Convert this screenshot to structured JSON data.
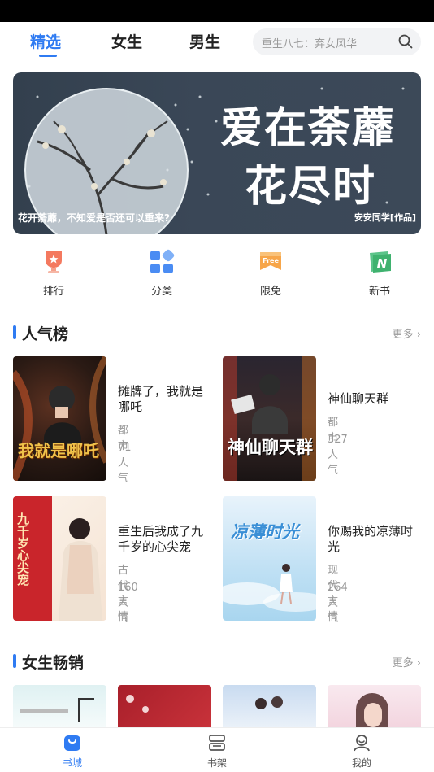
{
  "top_tabs": [
    {
      "label": "精选",
      "active": true
    },
    {
      "label": "女生",
      "active": false
    },
    {
      "label": "男生",
      "active": false
    }
  ],
  "search": {
    "placeholder": "重生八七：弃女风华",
    "icon": "search-icon"
  },
  "banner": {
    "title_line1": "爱在荼蘼",
    "title_line2": "花尽时",
    "caption": "花开荼蘼，不知爱是否还可以重来?",
    "author": "安安同学[作品]"
  },
  "quick_entries": [
    {
      "label": "排行",
      "icon": "trophy-icon"
    },
    {
      "label": "分类",
      "icon": "category-grid-icon"
    },
    {
      "label": "限免",
      "icon": "free-tag-icon"
    },
    {
      "label": "新书",
      "icon": "new-book-icon"
    }
  ],
  "sections": {
    "popular": {
      "title": "人气榜",
      "more": "更多",
      "books": [
        {
          "title": "摊牌了，我就是哪吒",
          "category": "都市",
          "popularity": "71人气",
          "cover_text": "我就是哪吒"
        },
        {
          "title": "神仙聊天群",
          "category": "都市",
          "popularity": "327人气",
          "cover_text": "神仙聊天群"
        },
        {
          "title": "重生后我成了九千岁的心尖宠",
          "category": "古代言情",
          "popularity": "160人气",
          "cover_text": "九千岁心尖宠"
        },
        {
          "title": "你赐我的凉薄时光",
          "category": "现代言情",
          "popularity": "264人气",
          "cover_text": "凉薄时光"
        }
      ]
    },
    "female_best": {
      "title": "女生畅销",
      "more": "更多"
    }
  },
  "bottom_nav": [
    {
      "label": "书城",
      "icon": "bookstore-icon",
      "active": true
    },
    {
      "label": "书架",
      "icon": "bookshelf-icon",
      "active": false
    },
    {
      "label": "我的",
      "icon": "profile-icon",
      "active": false
    }
  ],
  "colors": {
    "accent": "#2f7bf2",
    "muted": "#999999",
    "text": "#222222"
  }
}
